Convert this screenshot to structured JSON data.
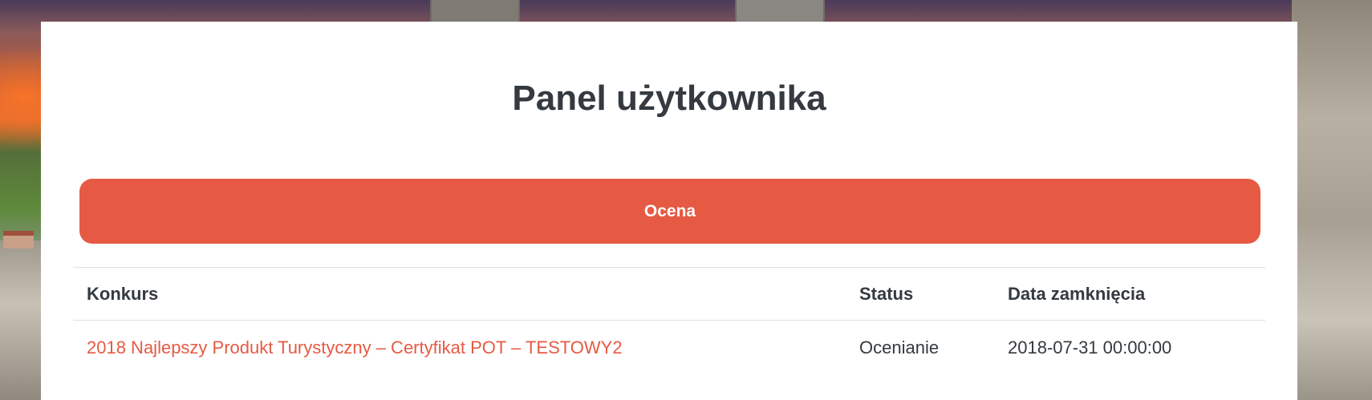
{
  "page": {
    "title": "Panel użytkownika",
    "accent_color": "#e65a43",
    "text_color": "#343a40"
  },
  "actions": {
    "ocena_label": "Ocena"
  },
  "table": {
    "headers": [
      "Konkurs",
      "Status",
      "Data zamknięcia"
    ],
    "rows": [
      {
        "konkurs": "2018 Najlepszy Produkt Turystyczny – Certyfikat POT – TESTOWY2",
        "status": "Ocenianie",
        "data_zamkniecia": "2018-07-31 00:00:00"
      }
    ]
  }
}
